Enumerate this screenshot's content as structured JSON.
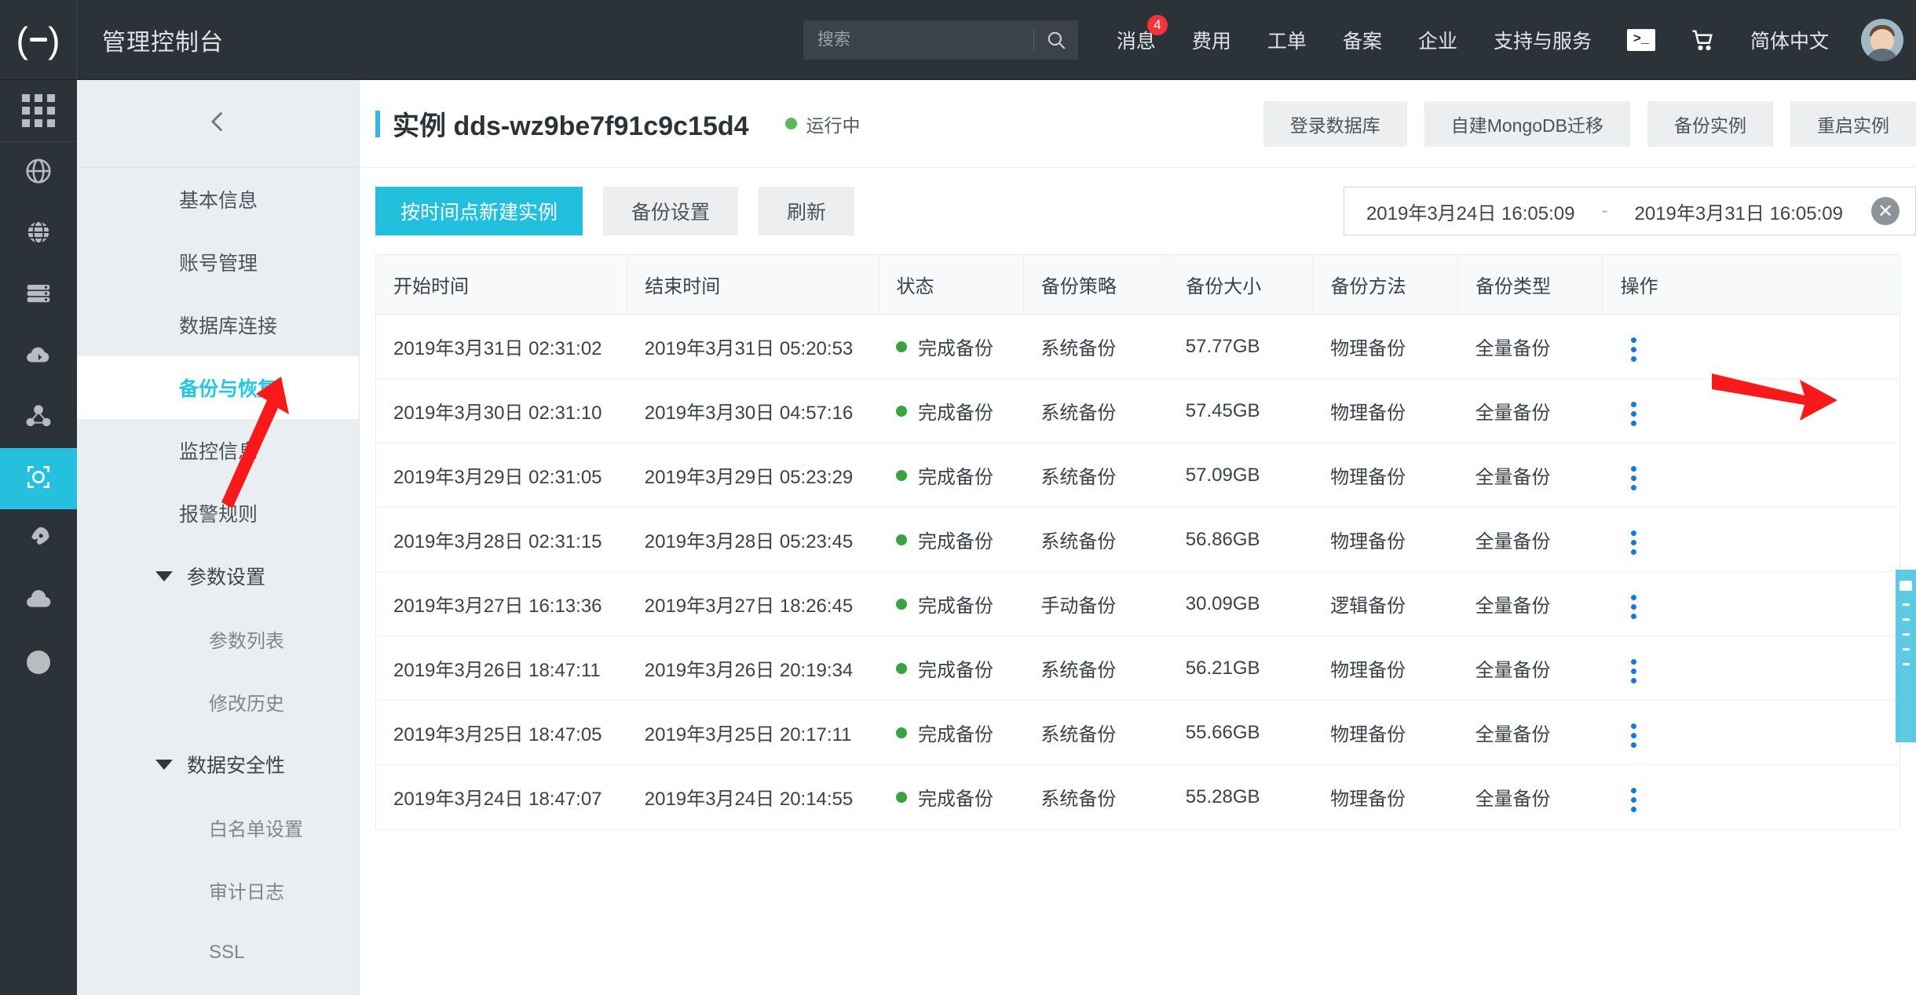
{
  "topbar": {
    "logo_icon": "alibaba-cloud-logo",
    "console_title": "管理控制台",
    "search": {
      "placeholder": "搜索",
      "value": "",
      "icon": "search-icon"
    },
    "nav": [
      {
        "label": "消息",
        "badge": "4"
      },
      {
        "label": "费用",
        "badge": ""
      },
      {
        "label": "工单",
        "badge": ""
      },
      {
        "label": "备案",
        "badge": ""
      },
      {
        "label": "企业",
        "badge": ""
      },
      {
        "label": "支持与服务",
        "badge": ""
      }
    ],
    "terminal_icon_label": ">_",
    "cart_icon": "shopping-cart-icon",
    "language": "简体中文",
    "avatar": "user-avatar"
  },
  "rail": {
    "items": [
      {
        "icon": "apps-grid-icon",
        "active": false
      },
      {
        "icon": "dns-icon",
        "active": false
      },
      {
        "icon": "globe-icon",
        "active": false
      },
      {
        "icon": "database-server-icon",
        "active": false
      },
      {
        "icon": "cloud-upload-icon",
        "active": false
      },
      {
        "icon": "network-nodes-icon",
        "active": false
      },
      {
        "icon": "mongodb-instance-icon",
        "active": true
      },
      {
        "icon": "rocket-icon",
        "active": false
      },
      {
        "icon": "cloud-icon",
        "active": false
      },
      {
        "icon": "circle-icon",
        "active": false
      }
    ]
  },
  "sidemenu": {
    "collapse_icon": "chevron-left-icon",
    "items": [
      {
        "label": "基本信息",
        "type": "item",
        "active": false
      },
      {
        "label": "账号管理",
        "type": "item",
        "active": false
      },
      {
        "label": "数据库连接",
        "type": "item",
        "active": false
      },
      {
        "label": "备份与恢复",
        "type": "item",
        "active": true
      },
      {
        "label": "监控信息",
        "type": "item",
        "active": false
      },
      {
        "label": "报警规则",
        "type": "item",
        "active": false
      },
      {
        "label": "参数设置",
        "type": "group",
        "active": false
      },
      {
        "label": "参数列表",
        "type": "sub",
        "active": false
      },
      {
        "label": "修改历史",
        "type": "sub",
        "active": false
      },
      {
        "label": "数据安全性",
        "type": "group",
        "active": false
      },
      {
        "label": "白名单设置",
        "type": "sub",
        "active": false
      },
      {
        "label": "审计日志",
        "type": "sub",
        "active": false
      },
      {
        "label": "SSL",
        "type": "sub",
        "active": false
      }
    ]
  },
  "page_head": {
    "title_prefix": "实例",
    "instance_id": "dds-wz9be7f91c9c15d4",
    "status_text": "运行中",
    "status_color": "#5cb85c",
    "actions": [
      "登录数据库",
      "自建MongoDB迁移",
      "备份实例",
      "重启实例"
    ]
  },
  "toolbar": {
    "primary_button": "按时间点新建实例",
    "buttons": [
      "备份设置",
      "刷新"
    ],
    "date_range": {
      "start": "2019年3月24日 16:05:09",
      "separator": "-",
      "end": "2019年3月31日 16:05:09",
      "clear_icon": "clear-circle-icon"
    }
  },
  "table": {
    "columns": [
      "开始时间",
      "结束时间",
      "状态",
      "备份策略",
      "备份大小",
      "备份方法",
      "备份类型",
      "操作"
    ],
    "rows": [
      {
        "start": "2019年3月31日 02:31:02",
        "end": "2019年3月31日 05:20:53",
        "status": "完成备份",
        "policy": "系统备份",
        "size": "57.77GB",
        "method": "物理备份",
        "type": "全量备份",
        "action_icon": "kebab-menu-icon"
      },
      {
        "start": "2019年3月30日 02:31:10",
        "end": "2019年3月30日 04:57:16",
        "status": "完成备份",
        "policy": "系统备份",
        "size": "57.45GB",
        "method": "物理备份",
        "type": "全量备份",
        "action_icon": "kebab-menu-icon"
      },
      {
        "start": "2019年3月29日 02:31:05",
        "end": "2019年3月29日 05:23:29",
        "status": "完成备份",
        "policy": "系统备份",
        "size": "57.09GB",
        "method": "物理备份",
        "type": "全量备份",
        "action_icon": "kebab-menu-icon"
      },
      {
        "start": "2019年3月28日 02:31:15",
        "end": "2019年3月28日 05:23:45",
        "status": "完成备份",
        "policy": "系统备份",
        "size": "56.86GB",
        "method": "物理备份",
        "type": "全量备份",
        "action_icon": "kebab-menu-icon"
      },
      {
        "start": "2019年3月27日 16:13:36",
        "end": "2019年3月27日 18:26:45",
        "status": "完成备份",
        "policy": "手动备份",
        "size": "30.09GB",
        "method": "逻辑备份",
        "type": "全量备份",
        "action_icon": "kebab-menu-icon"
      },
      {
        "start": "2019年3月26日 18:47:11",
        "end": "2019年3月26日 20:19:34",
        "status": "完成备份",
        "policy": "系统备份",
        "size": "56.21GB",
        "method": "物理备份",
        "type": "全量备份",
        "action_icon": "kebab-menu-icon"
      },
      {
        "start": "2019年3月25日 18:47:05",
        "end": "2019年3月25日 20:17:11",
        "status": "完成备份",
        "policy": "系统备份",
        "size": "55.66GB",
        "method": "物理备份",
        "type": "全量备份",
        "action_icon": "kebab-menu-icon"
      },
      {
        "start": "2019年3月24日 18:47:07",
        "end": "2019年3月24日 20:14:55",
        "status": "完成备份",
        "policy": "系统备份",
        "size": "55.28GB",
        "method": "物理备份",
        "type": "全量备份",
        "action_icon": "kebab-menu-icon"
      }
    ]
  },
  "side_tab": {
    "icon": "feedback-panel-icon"
  },
  "annotations": {
    "color": "#f81a1a",
    "arrow_to_sidebar_item": "备份与恢复",
    "arrow_to_row_action": "操作"
  },
  "colors": {
    "accent": "#23c0dd",
    "topbar_bg": "#2b3238",
    "sidebar_bg": "#eaeef1",
    "status_green": "#38a340",
    "badge_red": "#f4333c",
    "annotation_red": "#f81a1a"
  }
}
